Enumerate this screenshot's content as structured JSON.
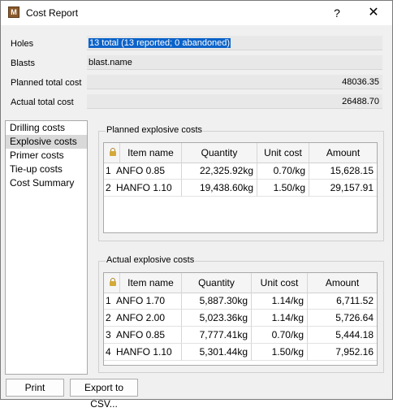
{
  "window": {
    "title": "Cost Report",
    "help_label": "?",
    "close_label": "✕",
    "app_icon": "cost-report-app-icon"
  },
  "fields": {
    "holes": {
      "label": "Holes",
      "value": "13 total (13 reported; 0 abandoned)"
    },
    "blasts": {
      "label": "Blasts",
      "value": "blast.name"
    },
    "planned_total": {
      "label": "Planned total cost",
      "value": "48036.35"
    },
    "actual_total": {
      "label": "Actual total cost",
      "value": "26488.70"
    }
  },
  "sidebar": {
    "items": [
      {
        "label": "Drilling costs"
      },
      {
        "label": "Explosive costs"
      },
      {
        "label": "Primer costs"
      },
      {
        "label": "Tie-up costs"
      },
      {
        "label": "Cost Summary"
      }
    ],
    "selected": "Explosive costs"
  },
  "planned": {
    "title": "Planned explosive costs",
    "columns": [
      "Item name",
      "Quantity",
      "Unit cost",
      "Amount"
    ],
    "rows": [
      {
        "num": "1",
        "item": "ANFO 0.85",
        "qty": "22,325.92kg",
        "unit": "0.70/kg",
        "amount": "15,628.15"
      },
      {
        "num": "2",
        "item": "HANFO 1.10",
        "qty": "19,438.60kg",
        "unit": "1.50/kg",
        "amount": "29,157.91"
      }
    ]
  },
  "actual": {
    "title": "Actual explosive costs",
    "columns": [
      "Item name",
      "Quantity",
      "Unit cost",
      "Amount"
    ],
    "rows": [
      {
        "num": "1",
        "item": "ANFO 1.70",
        "qty": "5,887.30kg",
        "unit": "1.14/kg",
        "amount": "6,711.52"
      },
      {
        "num": "2",
        "item": "ANFO 2.00",
        "qty": "5,023.36kg",
        "unit": "1.14/kg",
        "amount": "5,726.64"
      },
      {
        "num": "3",
        "item": "ANFO 0.85",
        "qty": "7,777.41kg",
        "unit": "0.70/kg",
        "amount": "5,444.18"
      },
      {
        "num": "4",
        "item": "HANFO 1.10",
        "qty": "5,301.44kg",
        "unit": "1.50/kg",
        "amount": "7,952.16"
      }
    ]
  },
  "buttons": {
    "print": "Print",
    "export": "Export to CSV..."
  },
  "colors": {
    "selection": "#0b63c9",
    "dialog_bg": "#f0f0f0"
  }
}
